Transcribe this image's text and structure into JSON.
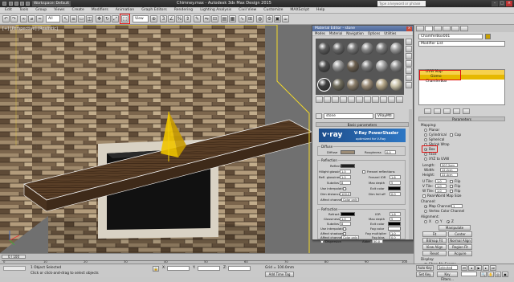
{
  "titlebar": {
    "workspace": "Workspace: Default",
    "title": "Chimney.max - Autodesk 3ds Max Design 2015",
    "search_placeholder": "Type a keyword or phrase"
  },
  "menus": [
    "Edit",
    "Tools",
    "Group",
    "Views",
    "Create",
    "Modifiers",
    "Animation",
    "Graph Editors",
    "Rendering",
    "Lighting Analysis",
    "Civil View",
    "Customize",
    "MAXScript",
    "Help"
  ],
  "toolbar": {
    "selection_filter": "All",
    "view_ref": "View"
  },
  "viewport": {
    "label": "[+] [Perspective] [Realistic]"
  },
  "material_editor": {
    "title": "Material Editor - stone",
    "menus": [
      "Modes",
      "Material",
      "Navigation",
      "Options",
      "Utilities"
    ],
    "slot_colors": [
      "#5b5b5b",
      "#6a6a6a",
      "#777777",
      "#8a8a8a",
      "#7d7d7d",
      "#9a9a9a",
      "#4c4c4c",
      "#999999",
      "#6c6050",
      "#7f7f7f",
      "#a5a5a5",
      "#8e8e8e",
      "#3f3f3f",
      "#706c5c",
      "#8b7e6a",
      "#9c8d78",
      "#b5a788",
      "#c9c2a8"
    ],
    "material_name": "stone",
    "material_type": "VRayMtl",
    "basic_params": "Basic parameters",
    "banner_logo": "v·ray",
    "banner_line1": "V-Ray PowerShader",
    "banner_line2": "optimized for V-Ray",
    "diffuse_group": "Diffuse",
    "diffuse": "Diffuse",
    "roughness": "Roughness",
    "roughness_val": "0.0",
    "reflection_group": "Reflection",
    "reflect": "Reflect",
    "hilight_gloss": "Hilight glossiness",
    "hilight_gloss_val": "1.0",
    "refl_gloss": "Refl. glossiness",
    "refl_gloss_val": "1.0",
    "subdivs": "Subdivs",
    "subdivs_val": "8",
    "use_interp": "Use interpolation",
    "dim_distance": "Dim distance",
    "dim_distance_val": "100.0",
    "affect_channels": "Affect channels",
    "affect_channels_val": "Color only",
    "fresnel": "Fresnel reflections",
    "fresnel_ior": "Fresnel IOR",
    "fresnel_ior_val": "1.6",
    "max_depth": "Max depth",
    "max_depth_val": "5",
    "exit_color": "Exit color",
    "dim_falloff": "Dim fall off",
    "dim_falloff_val": "0.0",
    "refraction_group": "Refraction",
    "refract": "Refract",
    "ior": "IOR",
    "ior_val": "1.6",
    "glossiness": "Glossiness",
    "glossiness_val": "1.0",
    "r_subdivs": "Subdivs",
    "r_subdivs_val": "8",
    "r_use_interp": "Use interpolation",
    "affect_shadows": "Affect shadows",
    "r_affect_channels": "Affect channels",
    "r_affect_channels_val": "Color only",
    "r_max_depth": "Max depth",
    "r_max_depth_val": "5",
    "r_exit_color": "Exit color",
    "fog_color": "Fog color",
    "fog_multiplier": "Fog multiplier",
    "fog_multiplier_val": "1.0",
    "fog_bias": "Fog bias",
    "fog_bias_val": "0.0",
    "dispersion": "Dispersion",
    "abbe": "Abbe",
    "abbe_val": "50.0"
  },
  "command_panel": {
    "object_name": "ChamferBox001",
    "modifier_list": "Modifier List",
    "stack": [
      "UVW Map",
      "Gizmo",
      "ChamferBox"
    ],
    "parameters": "Parameters",
    "mapping": "Mapping:",
    "mapping_opts": [
      "Planar",
      "Cylindrical",
      "Cap",
      "Spherical",
      "Shrink Wrap",
      "Box",
      "Face",
      "XYZ to UVW"
    ],
    "length": "Length:",
    "length_val": "207.2cm",
    "width": "Width:",
    "width_val": "12.2cm",
    "height": "Height:",
    "height_val": "22.4cm",
    "u_tile": "U Tile:",
    "u_tile_val": "1.0",
    "v_tile": "V Tile:",
    "v_tile_val": "1.0",
    "w_tile": "W Tile:",
    "w_tile_val": "1.0",
    "flip": "Flip",
    "real_world": "Real-World Map Size",
    "channel": "Channel:",
    "map_channel": "Map Channel:",
    "map_channel_val": "1",
    "vertex_color": "Vertex Color Channel",
    "alignment": "Alignment:",
    "axes": [
      "X",
      "Y",
      "Z"
    ],
    "manipulate": "Manipulate",
    "fit": "Fit",
    "center": "Center",
    "bitmap_fit": "Bitmap Fit",
    "normal_align": "Normal Align",
    "view_align": "View Align",
    "region_fit": "Region Fit",
    "reset": "Reset",
    "acquire": "Acquire",
    "display": "Display:",
    "show_no_seams": "Show No Seams",
    "thin_seam": "Thin Seam Display"
  },
  "trackbar": {
    "frame": "0 / 100",
    "ticks": [
      "0",
      "10",
      "20",
      "30",
      "40",
      "50",
      "60",
      "70",
      "80",
      "90",
      "100"
    ]
  },
  "status": {
    "selected": "1 Object Selected",
    "prompt": "Click or click-and-drag to select objects",
    "x_label": "X:",
    "y_label": "Y:",
    "z_label": "Z:",
    "grid": "Grid = 100.0mm",
    "add_time_tag": "Add Time Tag",
    "auto_key": "Auto Key",
    "selected_dd": "Selected",
    "set_key": "Set Key",
    "key_filters": "Key Filters..."
  }
}
